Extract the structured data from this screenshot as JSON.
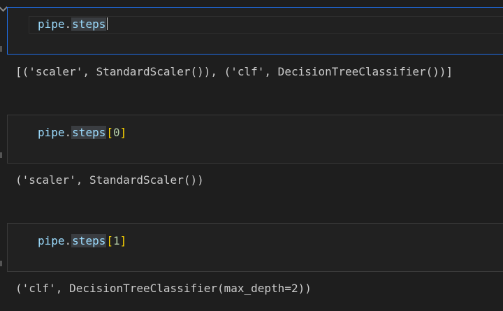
{
  "cells": [
    {
      "code": {
        "var": "pipe",
        "dot": ".",
        "attr": "steps",
        "open": "",
        "index": "",
        "close": ""
      },
      "output": "[('scaler', StandardScaler()), ('clf', DecisionTreeClassifier())]"
    },
    {
      "code": {
        "var": "pipe",
        "dot": ".",
        "attr": "steps",
        "open": "[",
        "index": "0",
        "close": "]"
      },
      "output": "('scaler', StandardScaler())"
    },
    {
      "code": {
        "var": "pipe",
        "dot": ".",
        "attr": "steps",
        "open": "[",
        "index": "1",
        "close": "]"
      },
      "output": "('clf', DecisionTreeClassifier(max_depth=2))"
    }
  ],
  "colors": {
    "background": "#1e1e1e",
    "cell_background": "#212121",
    "active_border": "#1f6feb",
    "variable": "#9cdcfe",
    "bracket": "#ffd700",
    "number": "#b5cea8"
  },
  "icons": [
    "collapse-chevron-icon"
  ]
}
